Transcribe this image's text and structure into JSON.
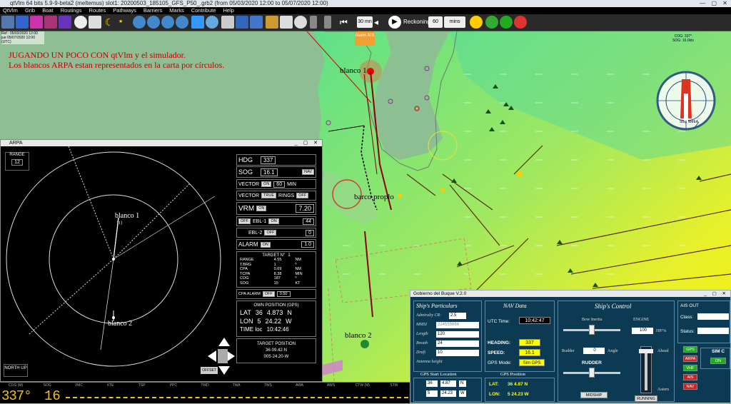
{
  "app": {
    "title": "qtVlm 64 bits 5.9-9-beta2 (meltemus) slot1: 20200503_185105_GFS_P50_.grb2 (from 05/03/2020 12:00 to 05/07/2020 12:00)",
    "window_controls": "— ▢ ✕"
  },
  "menu": [
    "QtVlm",
    "Grib",
    "Boat",
    "Routings",
    "Routes",
    "Pathways",
    "Barriers",
    "Marks",
    "Contribute",
    "Help"
  ],
  "toolbar": {
    "time_step": "30 mn",
    "reckoning_label": "Reckoning",
    "reckoning_value": "60",
    "reckoning_unit": "mins"
  },
  "chart_info": {
    "ref": "Ref : 05/03/2020 12:00",
    "date": "jue 05/07/2020 12:00",
    "utc": "(UTC)"
  },
  "annotation": {
    "line1": "JUGANDO UN POCO CON qtVlm y el simulador.",
    "line2": "Los blancos ARPA estan representados en la carta por círculos."
  },
  "map_labels": {
    "blanco1": "blanco 1",
    "blanco2": "blanco 2",
    "own": "barco proplo",
    "alarm": "Alarm AIS"
  },
  "compass": {
    "cog": "COG: 337°",
    "sog": "SOG: 16.0kts",
    "stop": "Stop NMEA"
  },
  "arpa": {
    "title": "ARPA",
    "range_label": "RANGE",
    "range_value": "12",
    "north_up": "NORTH UP",
    "offset": "OFFSET",
    "blanco1": "blanco 1",
    "blanco2": "blanco 2",
    "target_tag": "[1]",
    "hdg_label": "HDG",
    "hdg_value": "337",
    "sog_label": "SOG",
    "sog_value": "16.1",
    "nav_btn": "NAV",
    "vector_label": "VECTOR",
    "vector_on": "ON",
    "vector_min_value": "60",
    "vector_min": "MIN",
    "vector2_true": "TRUE",
    "rings": "RINGS",
    "rings_off": "OFF",
    "vrm_label": "VRM",
    "vrm_on": "ON",
    "vrm_value": "7.20",
    "ebl1_off": "OFF",
    "ebl1_label": "EBL-1",
    "ebl1_on": "ON",
    "ebl1_value": "44",
    "ebl2_label": "EBL-2",
    "ebl2_off": "OFF",
    "ebl2_value": "0",
    "alarm_label": "ALARM",
    "alarm_on": "ON",
    "alarm_value": "1.0",
    "target_no_label": "TARGET N°",
    "target_no": "1",
    "target_rows": [
      [
        "RANGE",
        "4.55",
        "NM"
      ],
      [
        "T.BRG",
        "1",
        "º"
      ],
      [
        "CPA",
        "0.69",
        "NM"
      ],
      [
        "TCPA",
        "8.38",
        "MIN"
      ],
      [
        "COG",
        "187",
        "º"
      ],
      [
        "SOG",
        "15",
        "KT"
      ]
    ],
    "cpa_alarm": "CPA ALARM",
    "cpa_alarm_off": "OFF",
    "cpa_alarm_value": "0.50",
    "own_pos_title": "OWN POSITION   (GPS)",
    "lat_label": "LAT",
    "lat_deg": "36",
    "lat_min": "4.873",
    "lat_hem": "N",
    "lon_label": "LON",
    "lon_deg": "5",
    "lon_min": "24.22",
    "lon_hem": "W",
    "time_label": "TIME loc",
    "time_value": "10:42:46",
    "target_pos_title": "TARGET POSITION",
    "target_lat": "36·09.42·N",
    "target_lon": "005·24.20·W"
  },
  "statusbar": {
    "heads": [
      "COG (M)",
      "SOG",
      "VMC",
      "XTE",
      "TSP",
      "PPC",
      "TWD",
      "TWA",
      "TWS",
      "AWA",
      "AWS",
      "CTW (M)",
      "STW"
    ],
    "cog": "337°",
    "sog": "16"
  },
  "gobierno": {
    "title": "Gobierno del Buque V.2.0",
    "particulars_title": "Ship's Particulars",
    "admiralty_label": "Admiralty CR:",
    "admiralty_value": "2.5",
    "mmsi_label": "MMSI",
    "mmsi_value": "224555666",
    "length_label": "Length",
    "length_value": "120",
    "breath_label": "Breath",
    "breath_value": "24",
    "draft_label": "Draft",
    "draft_value": "10",
    "antenna_label": "Antenna height",
    "gps_start_title": "GPS Start Location",
    "gps_lat_deg": "36",
    "gps_lat_min": "4.87",
    "gps_lat_hem": "N",
    "gps_lon_deg": "5",
    "gps_lon_min": "24.23",
    "gps_lon_hem": "W",
    "nav_title": "NAV Data",
    "utc_label": "UTC Time:",
    "utc_value": "10:42:47",
    "heading_label": "HEADING:",
    "heading_value": "337",
    "speed_label": "SPEED:",
    "speed_value": "16.1",
    "gps_mode_label": "GPS Mode:",
    "gps_mode_value": "Sim GPS",
    "gps_pos_title": "GPS Position",
    "gps_pos_lat_label": "LAT:",
    "gps_pos_lat": "36 4.87 N",
    "gps_pos_lon_label": "LON:",
    "gps_pos_lon": "5 24.23 W",
    "control_title": "Ship's Control",
    "bow_inertia": "Bow Inertia",
    "engine_label": "ENGINE",
    "engine_value": "100",
    "engine_unit": "HP/%",
    "rudder_label": "Rudder",
    "rudder_value": "0",
    "angle_label": "Angle",
    "rudder_title": "RUDDER",
    "midship": "MIDSHIP",
    "ahead": "Ahead",
    "astern": "Astern",
    "running": "RUNNING",
    "ais_out": "AIS OUT",
    "class_label": "Class:",
    "status_label": "Status:",
    "gps_btn": "GPS",
    "arpa_btn": "ARPA",
    "vhf_btn": "VHF",
    "ais_btn": "AIS",
    "nav_btn": "NAV",
    "sim_label": "SIM C",
    "on_btn": "ON"
  }
}
